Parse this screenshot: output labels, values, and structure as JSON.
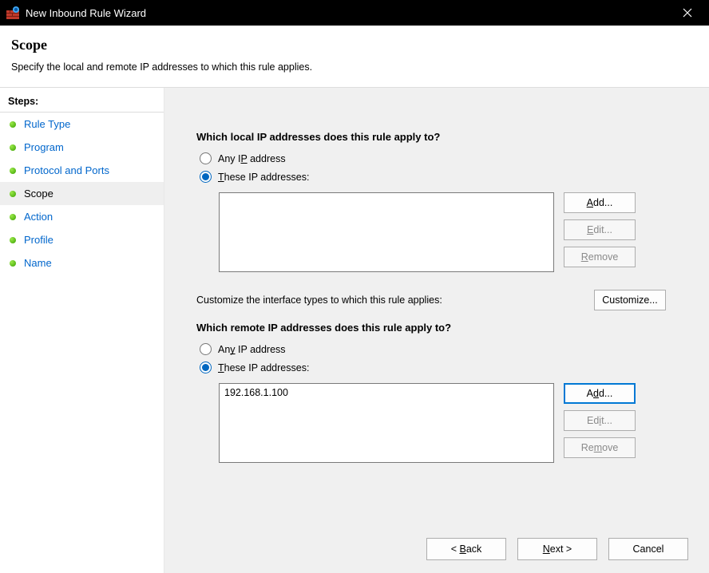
{
  "titlebar": {
    "title": "New Inbound Rule Wizard"
  },
  "header": {
    "title": "Scope",
    "subtitle": "Specify the local and remote IP addresses to which this rule applies."
  },
  "sidebar": {
    "heading": "Steps:",
    "items": [
      {
        "label": "Rule Type",
        "current": false
      },
      {
        "label": "Program",
        "current": false
      },
      {
        "label": "Protocol and Ports",
        "current": false
      },
      {
        "label": "Scope",
        "current": true
      },
      {
        "label": "Action",
        "current": false
      },
      {
        "label": "Profile",
        "current": false
      },
      {
        "label": "Name",
        "current": false
      }
    ]
  },
  "scope": {
    "local": {
      "question": "Which local IP addresses does this rule apply to?",
      "option_any_prefix": "Any I",
      "option_any_u": "P",
      "option_any_suffix": " address",
      "option_these_u": "T",
      "option_these_suffix": "hese IP addresses:",
      "selected": "these",
      "list_text": "",
      "buttons": {
        "add_u": "A",
        "add_suffix": "dd...",
        "edit_u": "E",
        "edit_suffix": "dit...",
        "remove_u": "R",
        "remove_suffix": "emove"
      }
    },
    "customize": {
      "label": "Customize the interface types to which this rule applies:",
      "button": "Customize..."
    },
    "remote": {
      "question": "Which remote IP addresses does this rule apply to?",
      "option_any_prefix": "An",
      "option_any_u": "y",
      "option_any_suffix": " IP address",
      "option_these_u": "T",
      "option_these_suffix": "hese IP addresses:",
      "selected": "these",
      "list_text": "192.168.1.100",
      "buttons": {
        "add_prefix": "A",
        "add_u": "d",
        "add_suffix": "d...",
        "edit_prefix": "Ed",
        "edit_u": "i",
        "edit_suffix": "t...",
        "remove_prefix": "Re",
        "remove_u": "m",
        "remove_suffix": "ove"
      }
    }
  },
  "footer": {
    "back_prefix": "< ",
    "back_u": "B",
    "back_suffix": "ack",
    "next_u": "N",
    "next_suffix": "ext >",
    "cancel": "Cancel"
  }
}
